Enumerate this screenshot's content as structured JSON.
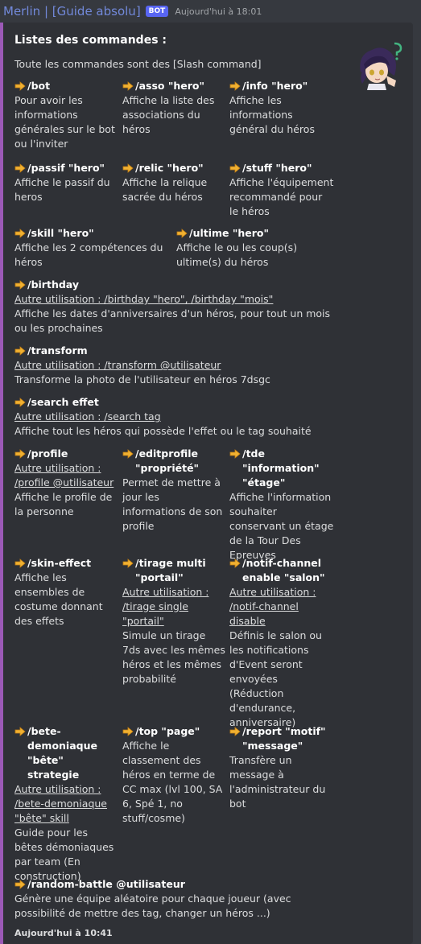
{
  "header": {
    "author": "Merlin | [Guide absolu]",
    "badge": "BOT",
    "timestamp": "Aujourd'hui à 18:01"
  },
  "embed": {
    "title": "Listes des commandes :",
    "description": "Toute les commandes sont des [Slash command]",
    "accent_color": "#9b59b6",
    "thumbnail_icon": "anime-character-avatar",
    "footer": "Aujourd'hui à 10:41",
    "fields": [
      {
        "name": "/bot",
        "value": "Pour avoir les informations générales sur le bot ou l'inviter"
      },
      {
        "name": "/asso \"hero\"",
        "value": "Affiche la liste des associations du héros"
      },
      {
        "name": "/info \"hero\"",
        "value": "Affiche les informations général du héros"
      },
      {
        "name": "/passif \"hero\"",
        "value": "Affiche le passif du heros"
      },
      {
        "name": "/relic \"hero\"",
        "value": "Affiche la relique sacrée du héros"
      },
      {
        "name": "/stuff \"hero\"",
        "value": "Affiche l'équipement recommandé pour le héros"
      },
      {
        "name": "/skill \"hero\"",
        "value": "Affiche les 2 compétences du héros"
      },
      {
        "name": "/ultime \"hero\"",
        "value": "Affiche le ou les coup(s) ultime(s) du héros"
      },
      {
        "name": "/birthday",
        "usage": "Autre utilisation : /birthday \"hero\", /birthday \"mois\"",
        "value": "Affiche les dates d'anniversaires d'un héros, pour tout un mois ou les prochaines"
      },
      {
        "name": "/transform",
        "usage": "Autre utilisation : /transform @utilisateur",
        "value": "Transforme la photo de l'utilisateur en héros 7dsgc"
      },
      {
        "name": "/search effet",
        "usage": "Autre utilisation : /search tag",
        "value": "Affiche tout les héros qui possède l'effet ou le tag souhaité"
      },
      {
        "name": "/profile",
        "usage": "Autre utilisation : /profile @utilisateur",
        "value": "Affiche le profile de la personne"
      },
      {
        "name": "/editprofile \"propriété\"",
        "value": "Permet de mettre à jour les informations de son profile"
      },
      {
        "name": "/tde \"information\" \"étage\"",
        "value": "Affiche l'information souhaiter conservant un étage de la Tour Des Epreuves"
      },
      {
        "name": "/skin-effect",
        "value": "Affiche les ensembles de costume donnant des effets"
      },
      {
        "name": "/tirage multi \"portail\"",
        "usage": "Autre utilisation : /tirage single \"portail\"",
        "value": "Simule un tirage 7ds avec les mêmes héros et les mêmes probabilité"
      },
      {
        "name": "/notif-channel enable \"salon\"",
        "usage": "Autre utilisation : /notif-channel disable",
        "value": "Définis le salon ou les notifications d'Event seront envoyées (Réduction d'endurance, anniversaire)"
      },
      {
        "name": "/bete-demoniaque \"bête\" strategie",
        "usage": "Autre utilisation : /bete-demoniaque \"bête\" skill",
        "value": "Guide pour les bêtes démoniaques par team (En construction)"
      },
      {
        "name": "/top \"page\"",
        "value": "Affiche le classement des héros en terme de CC max (lvl 100, SA 6, Spé 1, no stuff/cosme)"
      },
      {
        "name": "/report \"motif\" \"message\"",
        "value": "Transfère un message à l'administrateur du bot"
      },
      {
        "name": "/random-battle @utilisateur",
        "value": "Génère une équipe aléatoire pour chaque joueur (avec possibilité de mettre des tag, changer un héros ...)"
      }
    ]
  }
}
